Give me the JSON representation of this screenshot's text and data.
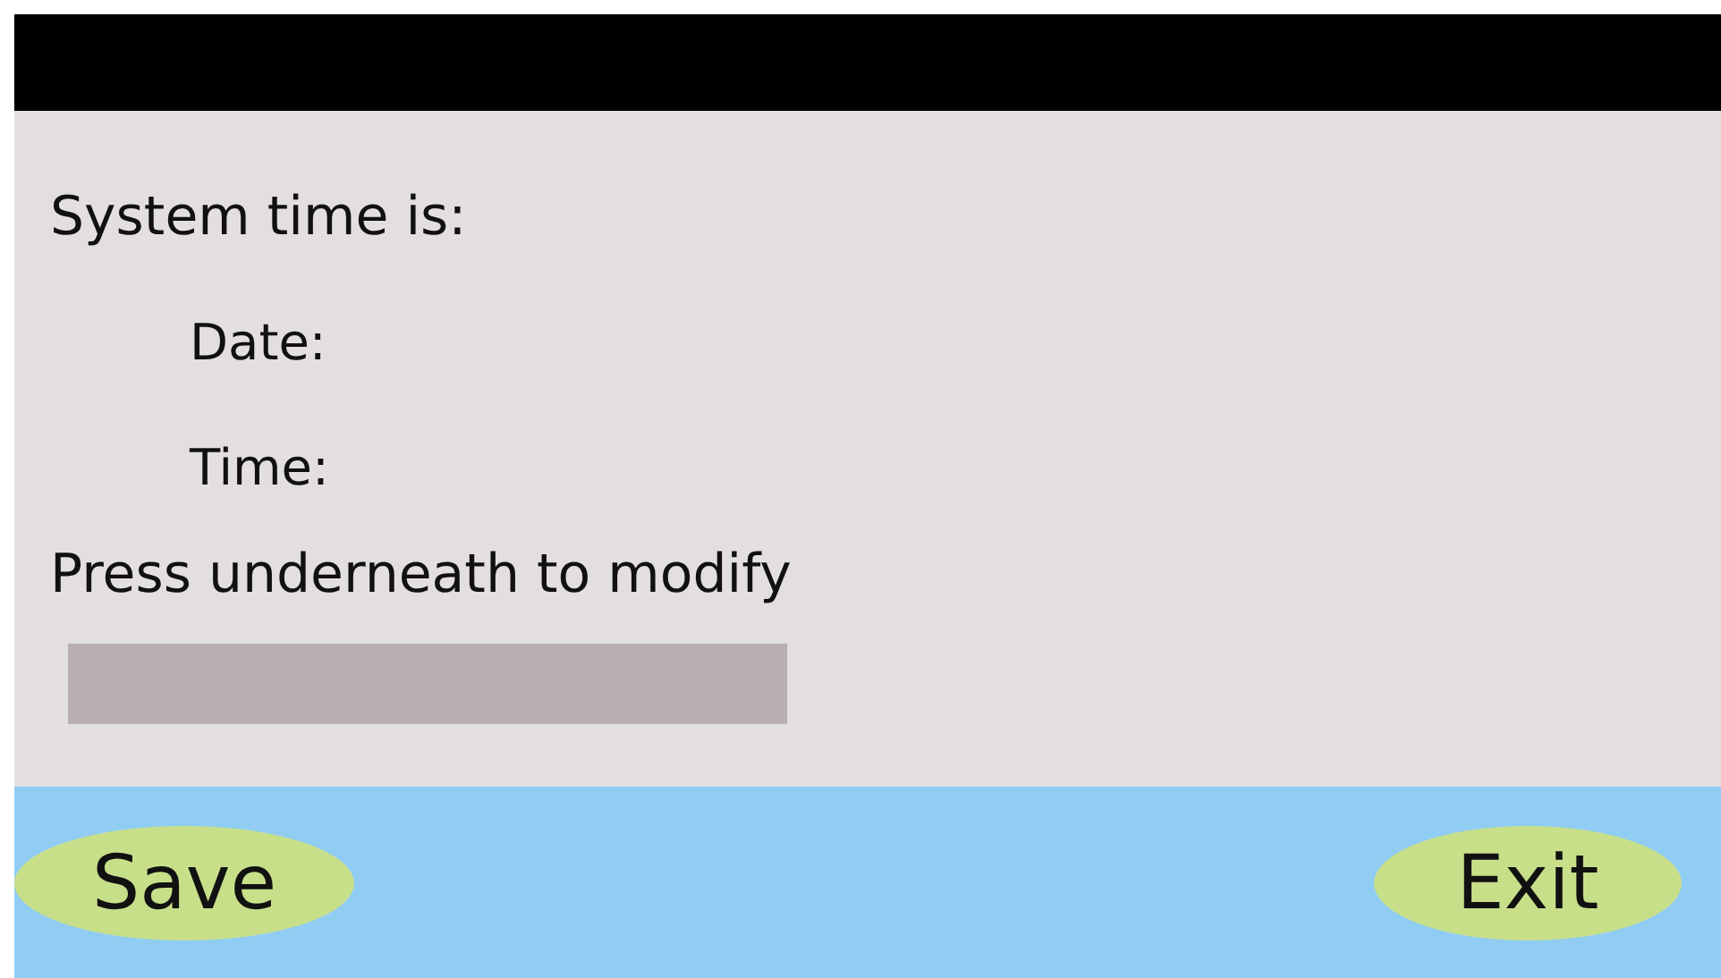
{
  "header": {
    "title": "System time is:"
  },
  "fields": [
    {
      "label": "Date:"
    },
    {
      "label": "Time:"
    }
  ],
  "instruction": "Press underneath to modify",
  "buttons": [
    {
      "label": "Save",
      "kind": "left"
    },
    {
      "label": "Exit",
      "kind": "right"
    }
  ]
}
